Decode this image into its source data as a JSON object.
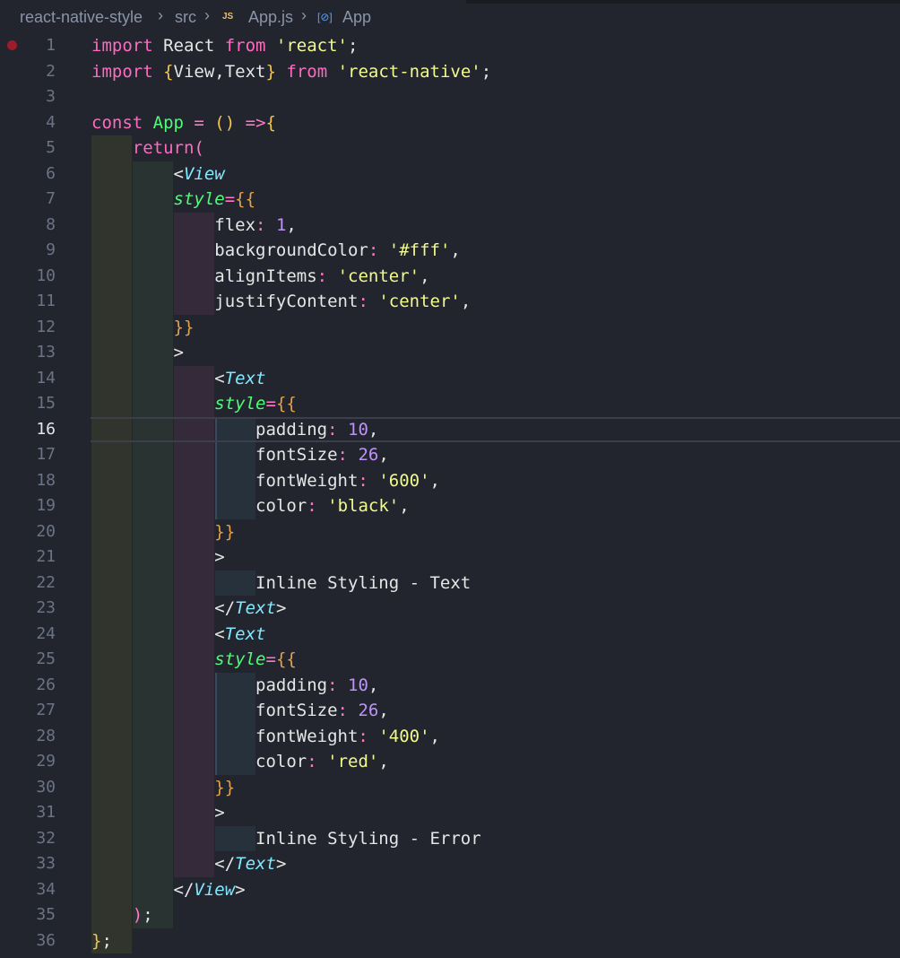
{
  "breadcrumb": {
    "items": [
      {
        "label": "react-native-style"
      },
      {
        "label": "src"
      },
      {
        "label": "App.js",
        "icon": "JS"
      },
      {
        "label": "App",
        "icon": "[⊘]"
      }
    ]
  },
  "editor": {
    "active_line": 16,
    "breakpoint_line": 1,
    "line_numbers": [
      "1",
      "2",
      "3",
      "4",
      "5",
      "6",
      "7",
      "8",
      "9",
      "10",
      "11",
      "12",
      "13",
      "14",
      "15",
      "16",
      "17",
      "18",
      "19",
      "20",
      "21",
      "22",
      "23",
      "24",
      "25",
      "26",
      "27",
      "28",
      "29",
      "30",
      "31",
      "32",
      "33",
      "34",
      "35",
      "36"
    ],
    "lines": [
      [
        [
          "kw",
          "import "
        ],
        [
          "id",
          "React "
        ],
        [
          "kw",
          "from "
        ],
        [
          "str",
          "'react'"
        ],
        [
          "plain",
          ";"
        ]
      ],
      [
        [
          "kw",
          "import "
        ],
        [
          "br1",
          "{"
        ],
        [
          "id",
          "View,Text"
        ],
        [
          "br1",
          "}"
        ],
        [
          "kw",
          " from "
        ],
        [
          "str",
          "'react-native'"
        ],
        [
          "plain",
          ";"
        ]
      ],
      [],
      [
        [
          "kw",
          "const "
        ],
        [
          "fn",
          "App "
        ],
        [
          "op",
          "= "
        ],
        [
          "br1",
          "() "
        ],
        [
          "op",
          "=>"
        ],
        [
          "br1",
          "{"
        ]
      ],
      [
        [
          "plain",
          "    "
        ],
        [
          "kw",
          "return"
        ],
        [
          "br2",
          "("
        ]
      ],
      [
        [
          "plain",
          "        "
        ],
        [
          "plain",
          "<"
        ],
        [
          "tag",
          "View"
        ]
      ],
      [
        [
          "plain",
          "        "
        ],
        [
          "attr",
          "style"
        ],
        [
          "op",
          "="
        ],
        [
          "br3",
          "{{"
        ]
      ],
      [
        [
          "plain",
          "            "
        ],
        [
          "id",
          "flex"
        ],
        [
          "op",
          ": "
        ],
        [
          "num",
          "1"
        ],
        [
          "plain",
          ","
        ]
      ],
      [
        [
          "plain",
          "            "
        ],
        [
          "id",
          "backgroundColor"
        ],
        [
          "op",
          ": "
        ],
        [
          "str",
          "'#fff'"
        ],
        [
          "plain",
          ","
        ]
      ],
      [
        [
          "plain",
          "            "
        ],
        [
          "id",
          "alignItems"
        ],
        [
          "op",
          ": "
        ],
        [
          "str",
          "'center'"
        ],
        [
          "plain",
          ","
        ]
      ],
      [
        [
          "plain",
          "            "
        ],
        [
          "id",
          "justifyContent"
        ],
        [
          "op",
          ": "
        ],
        [
          "str",
          "'center'"
        ],
        [
          "plain",
          ","
        ]
      ],
      [
        [
          "plain",
          "        "
        ],
        [
          "br3",
          "}}"
        ]
      ],
      [
        [
          "plain",
          "        "
        ],
        [
          "plain",
          ">"
        ]
      ],
      [
        [
          "plain",
          "            "
        ],
        [
          "plain",
          "<"
        ],
        [
          "tag",
          "Text"
        ]
      ],
      [
        [
          "plain",
          "            "
        ],
        [
          "attr",
          "style"
        ],
        [
          "op",
          "="
        ],
        [
          "br3",
          "{{"
        ]
      ],
      [
        [
          "plain",
          "                "
        ],
        [
          "id",
          "padding"
        ],
        [
          "op",
          ": "
        ],
        [
          "num",
          "10"
        ],
        [
          "plain",
          ","
        ]
      ],
      [
        [
          "plain",
          "                "
        ],
        [
          "id",
          "fontSize"
        ],
        [
          "op",
          ": "
        ],
        [
          "num",
          "26"
        ],
        [
          "plain",
          ","
        ]
      ],
      [
        [
          "plain",
          "                "
        ],
        [
          "id",
          "fontWeight"
        ],
        [
          "op",
          ": "
        ],
        [
          "str",
          "'600'"
        ],
        [
          "plain",
          ","
        ]
      ],
      [
        [
          "plain",
          "                "
        ],
        [
          "id",
          "color"
        ],
        [
          "op",
          ": "
        ],
        [
          "str",
          "'black'"
        ],
        [
          "plain",
          ","
        ]
      ],
      [
        [
          "plain",
          "            "
        ],
        [
          "br3",
          "}}"
        ]
      ],
      [
        [
          "plain",
          "            "
        ],
        [
          "plain",
          ">"
        ]
      ],
      [
        [
          "plain",
          "                "
        ],
        [
          "plain",
          "Inline Styling - Text"
        ]
      ],
      [
        [
          "plain",
          "            "
        ],
        [
          "plain",
          "</"
        ],
        [
          "tag",
          "Text"
        ],
        [
          "plain",
          ">"
        ]
      ],
      [
        [
          "plain",
          "            "
        ],
        [
          "plain",
          "<"
        ],
        [
          "tag",
          "Text"
        ]
      ],
      [
        [
          "plain",
          "            "
        ],
        [
          "attr",
          "style"
        ],
        [
          "op",
          "="
        ],
        [
          "br3",
          "{{"
        ]
      ],
      [
        [
          "plain",
          "                "
        ],
        [
          "id",
          "padding"
        ],
        [
          "op",
          ": "
        ],
        [
          "num",
          "10"
        ],
        [
          "plain",
          ","
        ]
      ],
      [
        [
          "plain",
          "                "
        ],
        [
          "id",
          "fontSize"
        ],
        [
          "op",
          ": "
        ],
        [
          "num",
          "26"
        ],
        [
          "plain",
          ","
        ]
      ],
      [
        [
          "plain",
          "                "
        ],
        [
          "id",
          "fontWeight"
        ],
        [
          "op",
          ": "
        ],
        [
          "str",
          "'400'"
        ],
        [
          "plain",
          ","
        ]
      ],
      [
        [
          "plain",
          "                "
        ],
        [
          "id",
          "color"
        ],
        [
          "op",
          ": "
        ],
        [
          "str",
          "'red'"
        ],
        [
          "plain",
          ","
        ]
      ],
      [
        [
          "plain",
          "            "
        ],
        [
          "br3",
          "}}"
        ]
      ],
      [
        [
          "plain",
          "            "
        ],
        [
          "plain",
          ">"
        ]
      ],
      [
        [
          "plain",
          "                "
        ],
        [
          "plain",
          "Inline Styling - Error"
        ]
      ],
      [
        [
          "plain",
          "            "
        ],
        [
          "plain",
          "</"
        ],
        [
          "tag",
          "Text"
        ],
        [
          "plain",
          ">"
        ]
      ],
      [
        [
          "plain",
          "        "
        ],
        [
          "plain",
          "</"
        ],
        [
          "tag",
          "View"
        ],
        [
          "plain",
          ">"
        ]
      ],
      [
        [
          "plain",
          "    "
        ],
        [
          "br2",
          ")"
        ],
        [
          "plain",
          ";"
        ]
      ],
      [
        [
          "br1",
          "}"
        ],
        [
          "plain",
          ";"
        ]
      ]
    ]
  }
}
